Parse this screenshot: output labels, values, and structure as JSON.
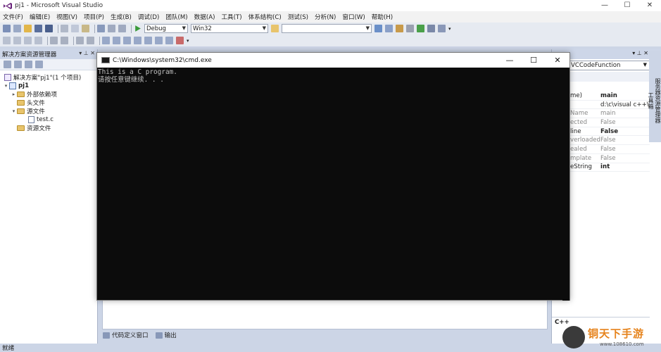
{
  "window": {
    "title": "pj1 - Microsoft Visual Studio",
    "min": "—",
    "max": "☐",
    "close": "✕"
  },
  "menu": [
    "文件(F)",
    "编辑(E)",
    "视图(V)",
    "项目(P)",
    "生成(B)",
    "调试(D)",
    "团队(M)",
    "数据(A)",
    "工具(T)",
    "体系结构(C)",
    "测试(S)",
    "分析(N)",
    "窗口(W)",
    "帮助(H)"
  ],
  "toolbar": {
    "config": "Debug",
    "platform": "Win32",
    "search_value": ""
  },
  "solution_explorer": {
    "title": "解决方案资源管理器",
    "pin": "▾ ⊥ ✕",
    "items": [
      {
        "label": "解决方案\"pj1\"(1 个项目)",
        "level": 0,
        "type": "solution"
      },
      {
        "label": "pj1",
        "level": 0,
        "type": "project",
        "toggle": "▾"
      },
      {
        "label": "外部依赖项",
        "level": 1,
        "type": "folder",
        "toggle": "▸"
      },
      {
        "label": "头文件",
        "level": 1,
        "type": "folder"
      },
      {
        "label": "源文件",
        "level": 1,
        "type": "folder",
        "toggle": "▾"
      },
      {
        "label": "test.c",
        "level": 2,
        "type": "file"
      },
      {
        "label": "资源文件",
        "level": 1,
        "type": "folder"
      }
    ]
  },
  "cmd": {
    "title": "C:\\Windows\\system32\\cmd.exe",
    "line1": "This is a C program.",
    "line2": "请按任意键继续. . .",
    "min": "—",
    "max": "☐",
    "close": "✕"
  },
  "properties": {
    "pins": "▾ ⊥ ✕",
    "selected": "VCCodeFunction",
    "rows": [
      {
        "k": "me)",
        "v": "main",
        "kdim": false,
        "vbold": true
      },
      {
        "k": "",
        "v": "d:\\c\\visual c++\\v",
        "kdim": false,
        "vbold": false
      },
      {
        "k": "Name",
        "v": "main",
        "kdim": true,
        "vbold": false,
        "vdim": true
      },
      {
        "k": "ected",
        "v": "False",
        "kdim": true,
        "vbold": false,
        "vdim": true
      },
      {
        "k": "line",
        "v": "False",
        "kdim": false,
        "vbold": true
      },
      {
        "k": "verloaded",
        "v": "False",
        "kdim": true,
        "vbold": false,
        "vdim": true
      },
      {
        "k": "ealed",
        "v": "False",
        "kdim": true,
        "vbold": false,
        "vdim": true
      },
      {
        "k": "mplate",
        "v": "False",
        "kdim": true,
        "vbold": false,
        "vdim": true
      },
      {
        "k": "eString",
        "v": "int",
        "kdim": false,
        "vbold": true
      }
    ],
    "description": "C++"
  },
  "side_strip": [
    "服务器资源管理器",
    "工具箱"
  ],
  "bottom_tabs": [
    "代码定义窗口",
    "输出"
  ],
  "status": "就绪",
  "watermark": {
    "text": "铜天下手游",
    "url": "www.108610.com"
  },
  "colors": {
    "accent": "#cdd6e8",
    "console_bg": "#0c0c0c",
    "console_fg": "#c0c0c0"
  }
}
